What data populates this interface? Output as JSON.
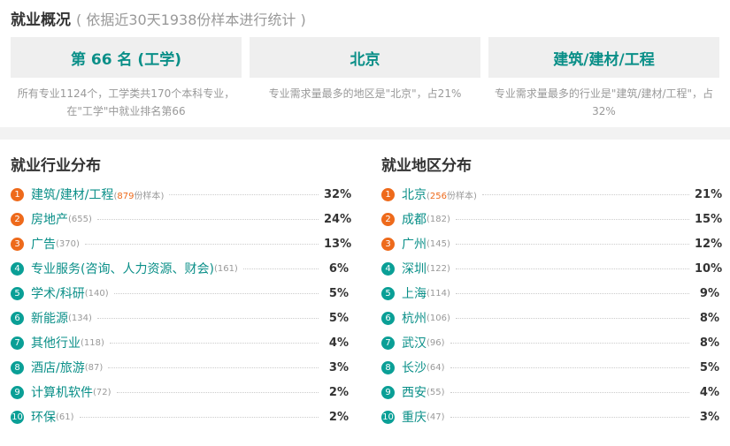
{
  "header": {
    "title": "就业概况",
    "subtitle": "( 依据近30天1938份样本进行统计 )"
  },
  "cards": [
    {
      "value": "第 66 名 (工学)",
      "desc": "所有专业1124个，工学类共170个本科专业，在\"工学\"中就业排名第66"
    },
    {
      "value": "北京",
      "desc": "专业需求量最多的地区是\"北京\"，占21%"
    },
    {
      "value": "建筑/建材/工程",
      "desc": "专业需求量最多的行业是\"建筑/建材/工程\"，占32%"
    }
  ],
  "industry": {
    "title": "就业行业分布",
    "items": [
      {
        "rank": "1",
        "name": "建筑/建材/工程",
        "count_num": "879",
        "count_suffix": "份样本",
        "pct": "32%"
      },
      {
        "rank": "2",
        "name": "房地产",
        "count": "(655)",
        "pct": "24%"
      },
      {
        "rank": "3",
        "name": "广告",
        "count": "(370)",
        "pct": "13%"
      },
      {
        "rank": "4",
        "name": "专业服务(咨询、人力资源、财会)",
        "count": "(161)",
        "pct": "6%"
      },
      {
        "rank": "5",
        "name": "学术/科研",
        "count": "(140)",
        "pct": "5%"
      },
      {
        "rank": "6",
        "name": "新能源",
        "count": "(134)",
        "pct": "5%"
      },
      {
        "rank": "7",
        "name": "其他行业",
        "count": "(118)",
        "pct": "4%"
      },
      {
        "rank": "8",
        "name": "酒店/旅游",
        "count": "(87)",
        "pct": "3%"
      },
      {
        "rank": "9",
        "name": "计算机软件",
        "count": "(72)",
        "pct": "2%"
      },
      {
        "rank": "10",
        "name": "环保",
        "count": "(61)",
        "pct": "2%"
      }
    ]
  },
  "region": {
    "title": "就业地区分布",
    "items": [
      {
        "rank": "1",
        "name": "北京",
        "count_num": "256",
        "count_suffix": "份样本",
        "pct": "21%"
      },
      {
        "rank": "2",
        "name": "成都",
        "count": "(182)",
        "pct": "15%"
      },
      {
        "rank": "3",
        "name": "广州",
        "count": "(145)",
        "pct": "12%"
      },
      {
        "rank": "4",
        "name": "深圳",
        "count": "(122)",
        "pct": "10%"
      },
      {
        "rank": "5",
        "name": "上海",
        "count": "(114)",
        "pct": "9%"
      },
      {
        "rank": "6",
        "name": "杭州",
        "count": "(106)",
        "pct": "8%"
      },
      {
        "rank": "7",
        "name": "武汉",
        "count": "(96)",
        "pct": "8%"
      },
      {
        "rank": "8",
        "name": "长沙",
        "count": "(64)",
        "pct": "5%"
      },
      {
        "rank": "9",
        "name": "西安",
        "count": "(55)",
        "pct": "4%"
      },
      {
        "rank": "10",
        "name": "重庆",
        "count": "(47)",
        "pct": "3%"
      }
    ]
  }
}
